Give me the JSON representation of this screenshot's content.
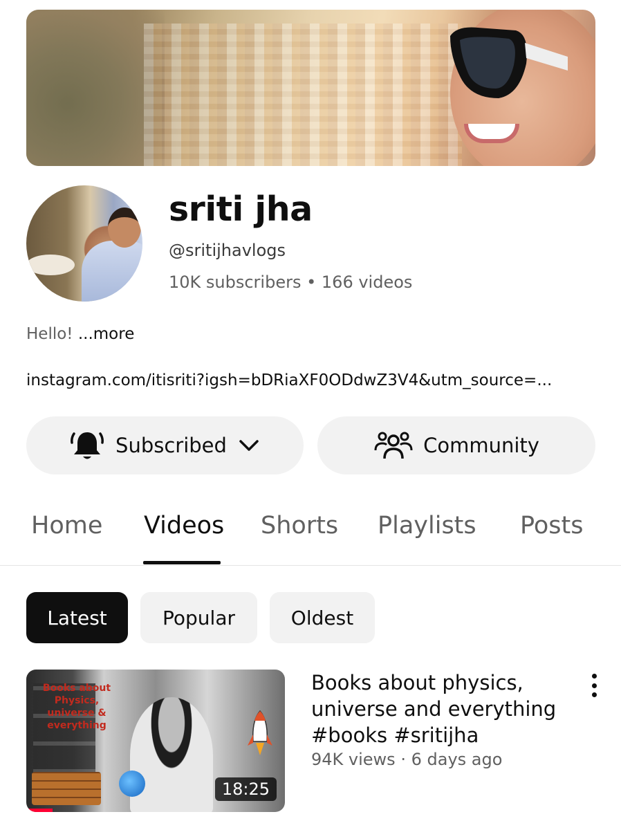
{
  "channel": {
    "name": "sriti jha",
    "handle": "@sritijhavlogs",
    "subscribers": "10K subscribers",
    "separator": "•",
    "videos": "166 videos",
    "description": "Hello!",
    "more_label": "...more",
    "link": "instagram.com/itisriti?igsh=bDRiaXF0ODdwZ3V4&utm_source=..."
  },
  "actions": {
    "subscribed_label": "Subscribed",
    "community_label": "Community"
  },
  "tabs": [
    {
      "label": "Home"
    },
    {
      "label": "Videos"
    },
    {
      "label": "Shorts"
    },
    {
      "label": "Playlists"
    },
    {
      "label": "Posts"
    }
  ],
  "active_tab": "Videos",
  "chips": [
    {
      "label": "Latest"
    },
    {
      "label": "Popular"
    },
    {
      "label": "Oldest"
    }
  ],
  "videos": [
    {
      "title": "Books about physics, universe and everything #books #sritijha",
      "views": "94K views",
      "age": "6 days ago",
      "meta_separator": "·",
      "duration": "18:25",
      "thumb_text": "Books about Physics, universe & everything"
    }
  ],
  "colors": {
    "text_primary": "#0f0f0f",
    "text_secondary": "#606060",
    "chip_bg": "#f2f2f2",
    "progress_red": "#ff0033"
  }
}
